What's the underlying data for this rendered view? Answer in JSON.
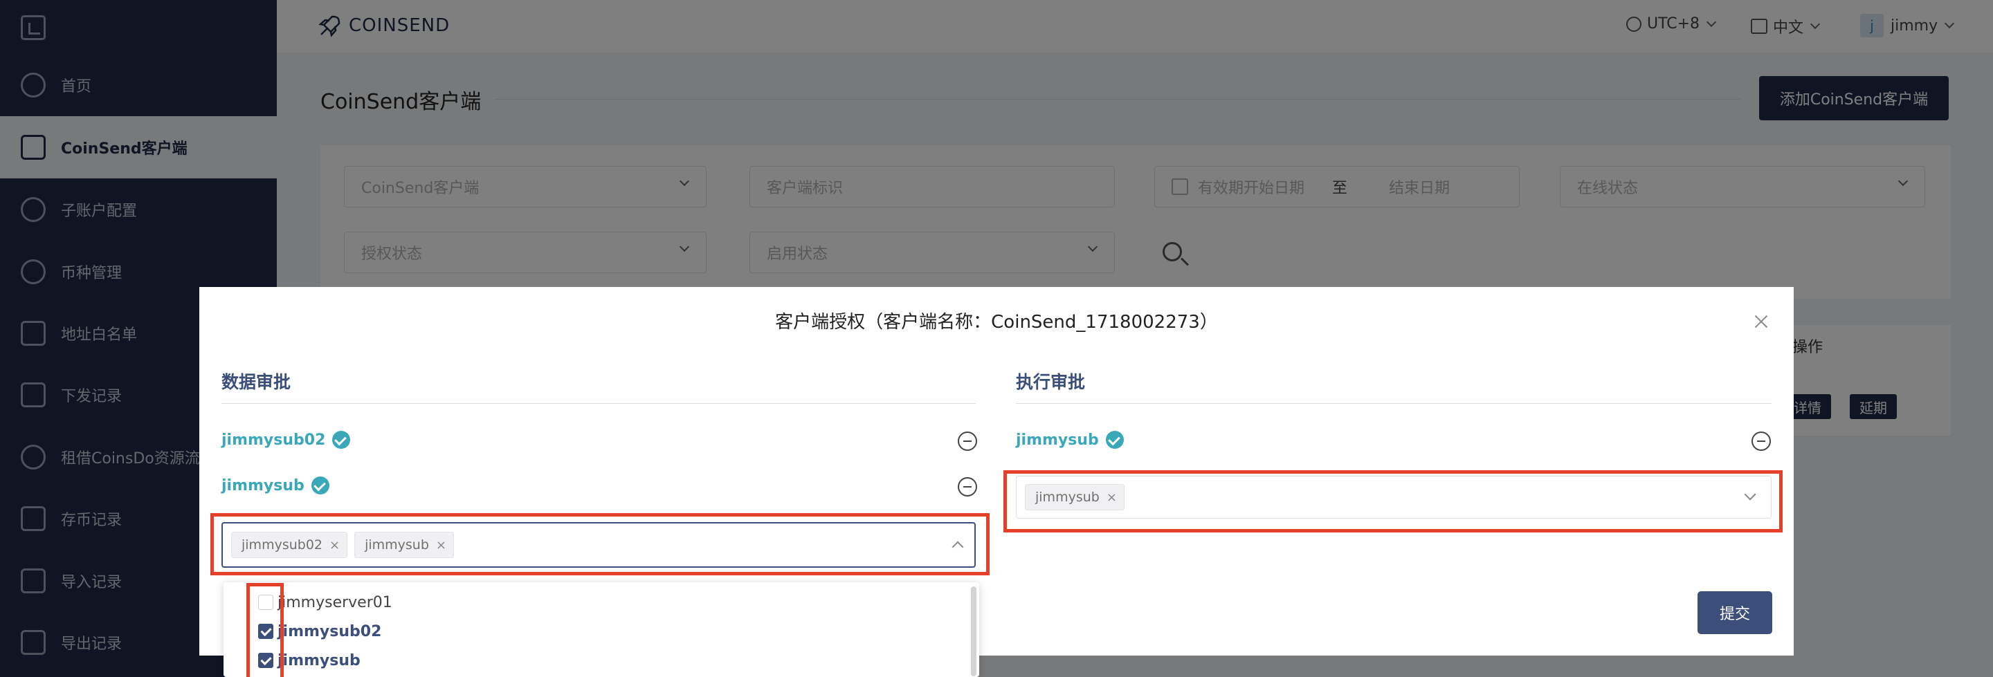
{
  "sidebar": {
    "items": [
      {
        "label": "首页",
        "icon": "dashboard-icon"
      },
      {
        "label": "CoinSend客户端",
        "icon": "wallet-icon"
      },
      {
        "label": "子账户配置",
        "icon": "user-icon"
      },
      {
        "label": "币种管理",
        "icon": "dollar-coin-icon"
      },
      {
        "label": "地址白名单",
        "icon": "document-icon"
      },
      {
        "label": "下发记录",
        "icon": "external-link-icon"
      },
      {
        "label": "租借CoinsDo资源流",
        "icon": "layers-icon"
      },
      {
        "label": "存币记录",
        "icon": "deposit-icon"
      },
      {
        "label": "导入记录",
        "icon": "import-icon"
      },
      {
        "label": "导出记录",
        "icon": "export-icon"
      }
    ],
    "active_index": 1
  },
  "header": {
    "brand": "COINSEND",
    "timezone": "UTC+8",
    "language": "中文",
    "user_initial": "j",
    "username": "jimmy"
  },
  "page": {
    "title": "CoinSend客户端",
    "add_button": "添加CoinSend客户端"
  },
  "filters": {
    "client_placeholder": "CoinSend客户端",
    "client_id_placeholder": "客户端标识",
    "start_date_placeholder": "有效期开始日期",
    "date_separator": "至",
    "end_date_placeholder": "结束日期",
    "online_status_placeholder": "在线状态",
    "auth_status_placeholder": "授权状态",
    "enable_status_placeholder": "启用状态"
  },
  "table": {
    "ops_header": "操作",
    "detail_button": "详情",
    "extend_button": "延期"
  },
  "modal": {
    "title": "客户端授权（客户端名称：CoinSend_1718002273）",
    "data_approval": {
      "heading": "数据审批",
      "approvers": [
        "jimmysub02",
        "jimmysub"
      ],
      "selected_tags": [
        "jimmysub02",
        "jimmysub"
      ],
      "options": [
        {
          "label": "jimmyserver01",
          "checked": false
        },
        {
          "label": "jimmysub02",
          "checked": true
        },
        {
          "label": "jimmysub",
          "checked": true
        }
      ]
    },
    "exec_approval": {
      "heading": "执行审批",
      "approvers": [
        "jimmysub"
      ],
      "selected_tags": [
        "jimmysub"
      ]
    },
    "submit_label": "提交"
  },
  "colors": {
    "sidebar_bg": "#1f2a47",
    "accent": "#3c4f7a",
    "approved_teal": "#3aa8b8",
    "highlight_red": "#e5402a"
  }
}
